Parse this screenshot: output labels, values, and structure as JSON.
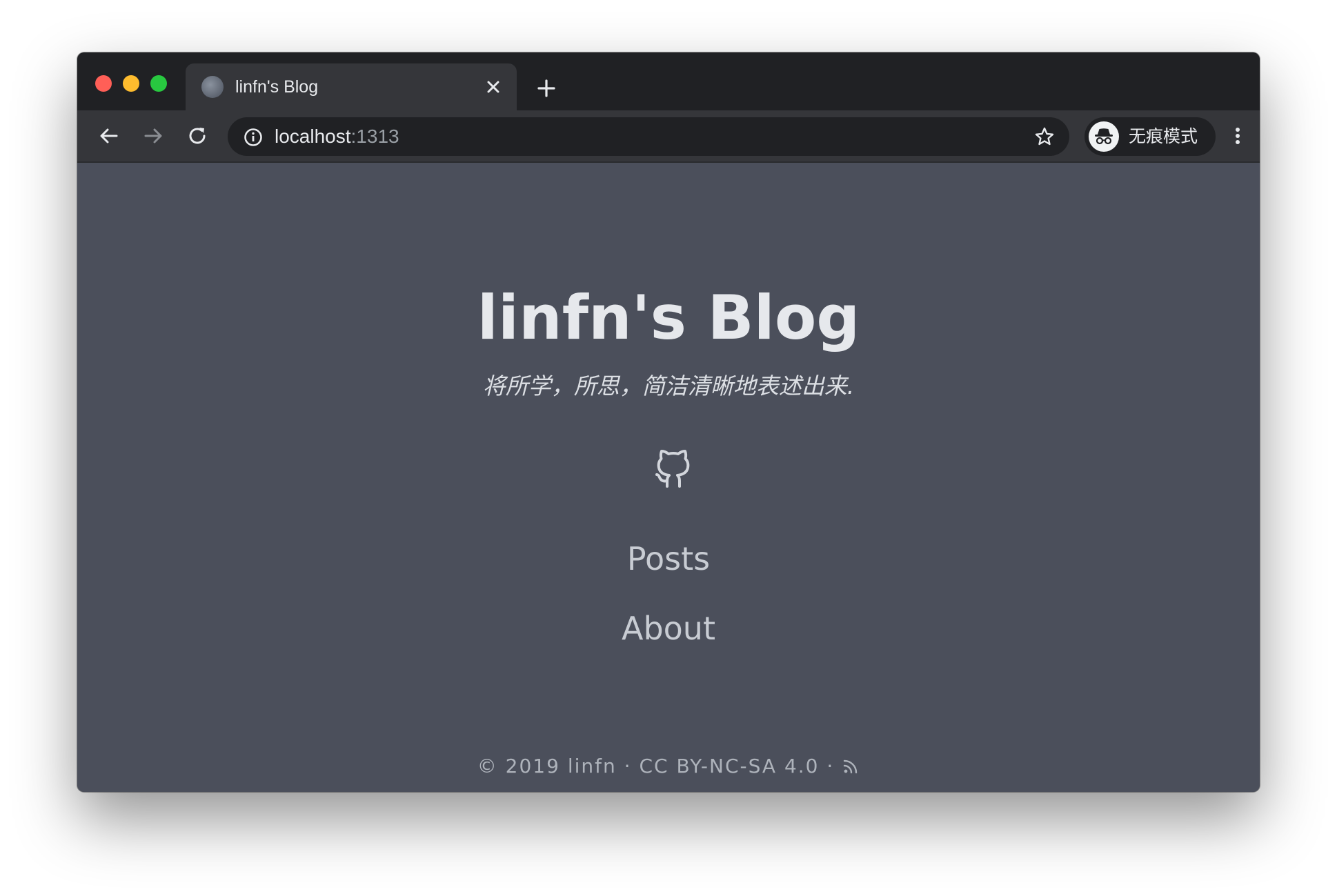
{
  "browser": {
    "tab": {
      "title": "linfn's Blog",
      "favicon": "site-favicon"
    },
    "address_bar": {
      "host": "localhost",
      "port": ":1313"
    },
    "profile": {
      "label": "无痕模式",
      "icon": "incognito-icon"
    },
    "icons": {
      "back": "back-arrow-icon",
      "forward": "forward-arrow-icon",
      "reload": "reload-icon",
      "info": "info-icon",
      "bookmark": "star-icon",
      "menu": "kebab-menu-icon",
      "close_tab": "close-icon",
      "new_tab": "plus-icon"
    },
    "colors": {
      "frame": "#202124",
      "toolbar": "#35363a",
      "page_background": "#4b4f5b"
    }
  },
  "page": {
    "title": "linfn's Blog",
    "tagline": "将所学，所思，简洁清晰地表述出来.",
    "social_icon": "github-icon",
    "nav": [
      {
        "label": "Posts"
      },
      {
        "label": "About"
      }
    ],
    "footer": {
      "copyright": "© 2019 linfn",
      "separator": "·",
      "license": "CC BY-NC-SA 4.0",
      "rss_icon": "rss-icon"
    }
  }
}
